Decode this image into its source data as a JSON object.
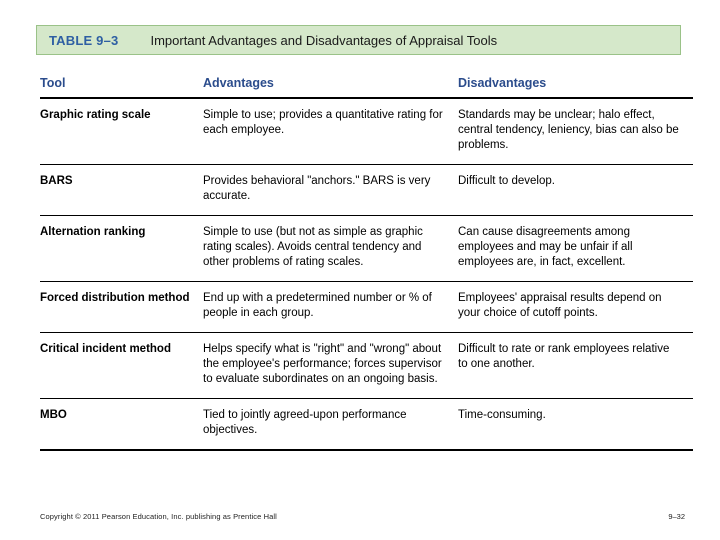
{
  "caption": {
    "label": "TABLE 9–3",
    "title": "Important Advantages and Disadvantages of Appraisal Tools",
    "band_color": "#d5e8ca",
    "band_border_color": "#9ac288",
    "label_color": "#2e5fa3"
  },
  "table": {
    "headers": {
      "tool": "Tool",
      "advantages": "Advantages",
      "disadvantages": "Disadvantages"
    },
    "header_color": "#2b4c8c",
    "rows": [
      {
        "tool": "Graphic rating scale",
        "advantages": "Simple to use; provides a quantitative rating for each employee.",
        "disadvantages": "Standards may be unclear; halo effect, central tendency, leniency, bias can also be problems."
      },
      {
        "tool": "BARS",
        "advantages": "Provides behavioral \"anchors.\" BARS is very accurate.",
        "disadvantages": "Difficult to develop."
      },
      {
        "tool": "Alternation ranking",
        "advantages": "Simple to use (but not as simple as graphic rating scales). Avoids central tendency and other problems of rating scales.",
        "disadvantages": "Can cause disagreements among employees and may be unfair if all employees are, in fact, excellent."
      },
      {
        "tool": "Forced distribution method",
        "advantages": "End up with a predetermined number or % of people in each group.",
        "disadvantages": "Employees' appraisal results depend on your choice of cutoff points."
      },
      {
        "tool": "Critical incident method",
        "advantages": "Helps specify what is \"right\" and \"wrong\" about the employee's performance; forces supervisor to evaluate subordinates on an ongoing basis.",
        "disadvantages": "Difficult to rate or rank employees relative to one another."
      },
      {
        "tool": "MBO",
        "advantages": "Tied to jointly agreed-upon performance objectives.",
        "disadvantages": "Time-consuming."
      }
    ]
  },
  "footer": {
    "copyright": "Copyright © 2011 Pearson Education, Inc. publishing as Prentice Hall",
    "page": "9–32"
  }
}
